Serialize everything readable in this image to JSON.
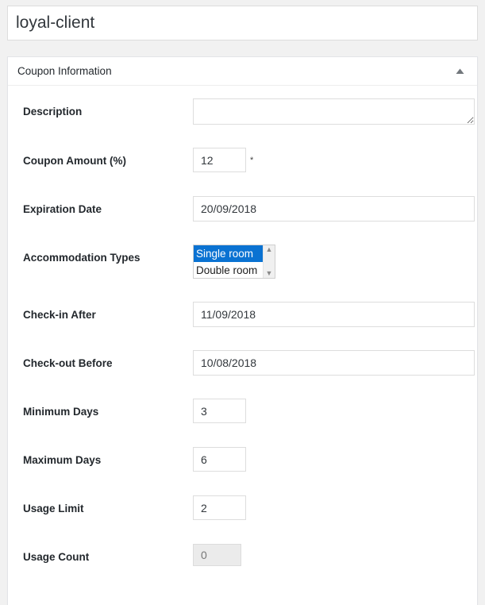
{
  "post": {
    "title_value": "loyal-client",
    "title_placeholder": "Enter title here"
  },
  "metabox": {
    "heading": "Coupon Information",
    "toggle_icon": "triangle-up-icon",
    "toggle_state": "expanded"
  },
  "fields": {
    "description": {
      "label": "Description",
      "value": "",
      "placeholder": ""
    },
    "coupon_amount": {
      "label": "Coupon Amount (%)",
      "value": "12",
      "required_marker": "*"
    },
    "expiration_date": {
      "label": "Expiration Date",
      "value": "20/09/2018"
    },
    "accommodation_types": {
      "label": "Accommodation Types",
      "options": [
        {
          "label": "Single room",
          "selected": true
        },
        {
          "label": "Double room",
          "selected": false
        }
      ],
      "scroll_up_icon": "chevron-up-icon",
      "scroll_down_icon": "chevron-down-icon"
    },
    "checkin_after": {
      "label": "Check-in After",
      "value": "11/09/2018"
    },
    "checkout_before": {
      "label": "Check-out Before",
      "value": "10/08/2018"
    },
    "minimum_days": {
      "label": "Minimum Days",
      "value": "3"
    },
    "maximum_days": {
      "label": "Maximum Days",
      "value": "6"
    },
    "usage_limit": {
      "label": "Usage Limit",
      "value": "2"
    },
    "usage_count": {
      "label": "Usage Count",
      "value": "0"
    }
  },
  "colors": {
    "page_bg": "#f1f1f1",
    "panel_bg": "#ffffff",
    "panel_border": "#e2e4e7",
    "label_text": "#23282d",
    "input_border": "#dddddd",
    "select_highlight": "#0a72d2",
    "disabled_bg": "#ebebeb"
  }
}
